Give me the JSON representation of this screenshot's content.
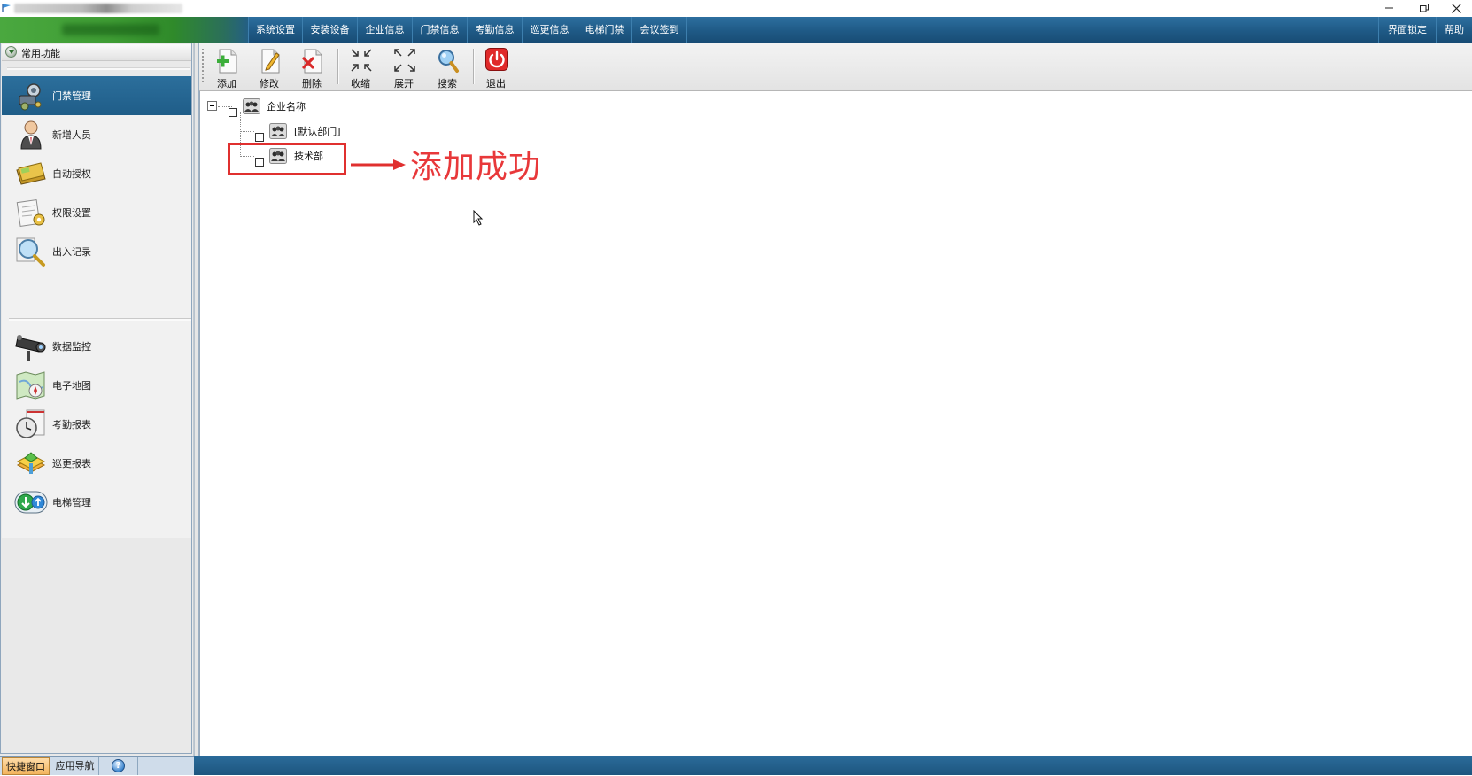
{
  "window": {
    "title": "",
    "controls": [
      "minimize-icon",
      "restore-icon",
      "close-icon"
    ]
  },
  "menu": {
    "items": [
      "系统设置",
      "安装设备",
      "企业信息",
      "门禁信息",
      "考勤信息",
      "巡更信息",
      "电梯门禁",
      "会议签到"
    ],
    "right_items": [
      "界面锁定",
      "帮助"
    ]
  },
  "sidebar": {
    "header": "常用功能",
    "items": [
      {
        "label": "门禁管理",
        "icon": "access-control-icon",
        "active": true
      },
      {
        "label": "新增人员",
        "icon": "person-icon"
      },
      {
        "label": "自动授权",
        "icon": "card-icon"
      },
      {
        "label": "权限设置",
        "icon": "permission-icon"
      },
      {
        "label": "出入记录",
        "icon": "magnifier-icon"
      },
      {
        "label": "数据监控",
        "icon": "camera-icon"
      },
      {
        "label": "电子地图",
        "icon": "map-icon"
      },
      {
        "label": "考勤报表",
        "icon": "clock-report-icon"
      },
      {
        "label": "巡更报表",
        "icon": "patrol-icon"
      },
      {
        "label": "电梯管理",
        "icon": "elevator-icon"
      }
    ],
    "bottom_tabs": {
      "quick": "快捷窗口",
      "nav": "应用导航",
      "help": "?"
    }
  },
  "toolbar": {
    "add": "添加",
    "edit": "修改",
    "delete": "删除",
    "collapse": "收缩",
    "expand": "展开",
    "search": "搜索",
    "exit": "退出"
  },
  "tree": {
    "root": "企业名称",
    "children": [
      "[默认部门]",
      "技术部"
    ]
  },
  "annotation": {
    "text": "添加成功",
    "color": "#e8383a"
  },
  "colors": {
    "menu_blue": "#1f5a86",
    "sidebar_active": "#2c6f9c",
    "brand_green": "#3f9d34"
  }
}
